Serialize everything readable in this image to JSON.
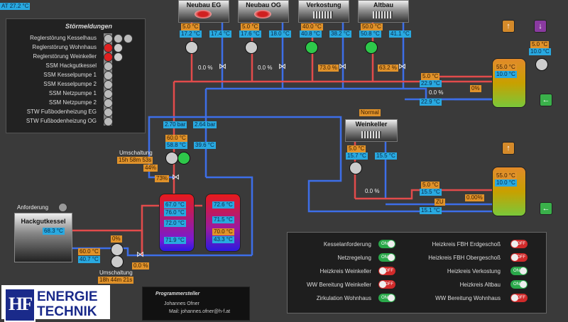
{
  "outdoor_temp": "AT 27.2 °C",
  "alarms": {
    "title": "Störmeldungen",
    "items": [
      {
        "label": "Reglerstörung Kesselhaus",
        "state": "grey"
      },
      {
        "label": "Reglerstörung Wohnhaus",
        "state": "red"
      },
      {
        "label": "Reglerstörung Weinkeller",
        "state": "red"
      },
      {
        "label": "SSM Hackgutkessel",
        "state": "grey"
      },
      {
        "label": "SSM Kesselpumpe 1",
        "state": "grey"
      },
      {
        "label": "SSM Kesselpumpe 2",
        "state": "grey"
      },
      {
        "label": "SSM Netzpumpe 1",
        "state": "grey"
      },
      {
        "label": "SSM Netzpumpe 2",
        "state": "grey"
      },
      {
        "label": "STW Fußbodenheizung EG",
        "state": "grey"
      },
      {
        "label": "STW Fußbodenheizung OG",
        "state": "grey"
      }
    ]
  },
  "circuits": [
    {
      "name": "Neubau EG",
      "set": "5.0 °C",
      "flow": "17.2 °C",
      "ret": "17.4 °C",
      "valve": "0.0 %"
    },
    {
      "name": "Neubau OG",
      "set": "5.0 °C",
      "flow": "17.6 °C",
      "ret": "18.0 °C",
      "valve": "0.0 %"
    },
    {
      "name": "Verkostung",
      "set": "40.0 °C",
      "flow": "40.8 °C",
      "ret": "38.2 °C",
      "valve": "73.0 %"
    },
    {
      "name": "Altbau",
      "set": "50.0 °C",
      "flow": "50.8 °C",
      "ret": "41.1 °C",
      "valve": "63.2 %"
    }
  ],
  "dhw_top": {
    "tank_top": "55.0 °C",
    "tank_bot": "10.0 °C",
    "set": "5.0 °C",
    "hx_in": "22.9 °C",
    "valve": "0.0 %",
    "valve2": "0%",
    "ret": "22.9 °C",
    "side_set": "5.0 °C",
    "side_val": "10.0 °C"
  },
  "dhw_bottom": {
    "tank_top": "55.0 °C",
    "tank_bot": "10.0 °C",
    "set": "5.0 °C",
    "hx_in": "15.5 °C",
    "zu": "ZU",
    "valve": "0.00%",
    "ret": "15.1 °C"
  },
  "weinkeller": {
    "status": "Normal",
    "name": "Weinkeller",
    "set": "5.0 °C",
    "flow": "15.7 °C",
    "ret": "15.5 °C",
    "valve": "0.0 %"
  },
  "network": {
    "press1": "2.70 bar",
    "press2": "2.64 bar",
    "set": "60.0 °C",
    "flow": "58.8 °C",
    "ret": "39.6 °C"
  },
  "switch1": {
    "label": "Umschaltung",
    "time": "15h 58m 53s",
    "pct": "44%",
    "valve": "73%"
  },
  "buffer1": [
    "67.0 °C",
    "76.0 °C",
    "72.0 °C",
    "71.9 °C"
  ],
  "buffer2": [
    "72.6 °C",
    "71.5 °C",
    "70.0 °C",
    "43.3 °C"
  ],
  "boiler": {
    "request_label": "Anforderung",
    "name": "Hackgutkessel",
    "temp": "68.3 °C",
    "set": "60.0 °C",
    "ret": "40.7 °C",
    "valve_top": "0%",
    "valve": "0.0 %"
  },
  "switch2": {
    "label": "Umschaltung",
    "time": "18h 44m 21s"
  },
  "status": {
    "left": [
      {
        "label": "Kesselanforderung",
        "on": true
      },
      {
        "label": "Netzregelung",
        "on": true
      },
      {
        "label": "Heizkreis Weinkeller",
        "on": false
      },
      {
        "label": "WW Bereitung Weinkeller",
        "on": false
      },
      {
        "label": "Zirkulation Wohnhaus",
        "on": true
      }
    ],
    "right": [
      {
        "label": "Heizkreis FBH Erdgeschoß",
        "on": false
      },
      {
        "label": "Heizkreis FBH Obergeschoß",
        "on": false
      },
      {
        "label": "Heizkreis Verkostung",
        "on": true
      },
      {
        "label": "Heizkreis Altbau",
        "on": true
      },
      {
        "label": "WW Bereitung Wohnhaus",
        "on": false
      }
    ],
    "on_text": "ON",
    "off_text": "OFF"
  },
  "logo": {
    "line1": "ENERGIE",
    "line2": "TECHNIK",
    "mark": "HF"
  },
  "programmer": {
    "title": "Programmersteller",
    "name": "Johannes Ofner",
    "mail": "Mail: johannes.ofner@h-f.at"
  }
}
